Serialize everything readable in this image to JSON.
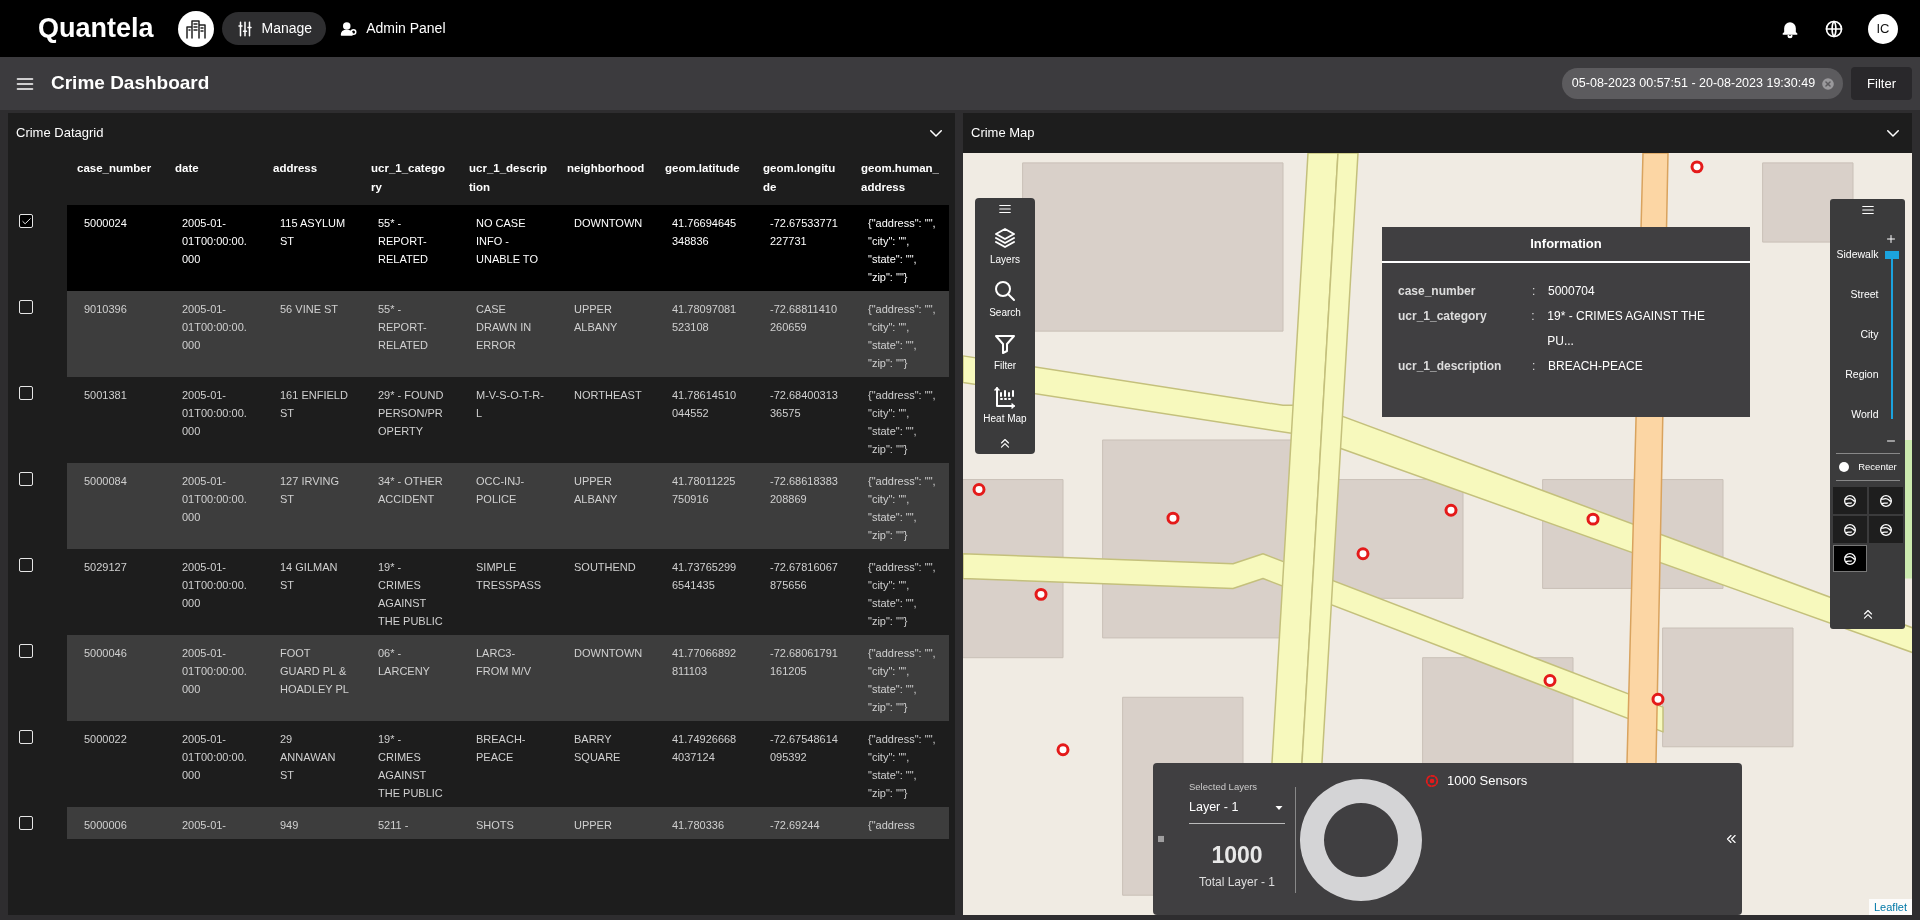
{
  "topbar": {
    "logo": "Quantela",
    "nav": [
      {
        "label": "Manage",
        "kind": "manage",
        "selected": true
      },
      {
        "label": "Admin Panel",
        "kind": "admin",
        "selected": false
      }
    ],
    "avatar": "IC"
  },
  "header": {
    "title": "Crime Dashboard",
    "date_range": "05-08-2023 00:57:51 - 20-08-2023 19:30:49",
    "filter_button": "Filter"
  },
  "datagrid": {
    "title": "Crime Datagrid",
    "columns": [
      "case_number",
      "date",
      "address",
      "ucr_1_category",
      "ucr_1_description",
      "neighborhood",
      "geom.latitude",
      "geom.longitude",
      "geom.human_address"
    ],
    "rows": [
      {
        "selected": true,
        "cells": [
          "5000024",
          "2005-01-01T00:00:00.000",
          "115 ASYLUM ST",
          "55* - REPORT-RELATED",
          "NO CASE INFO - UNABLE TO",
          "DOWNTOWN",
          "41.76694645348836",
          "-72.67533771227731",
          "{\"address\": \"\", \"city\": \"\", \"state\": \"\", \"zip\": \"\"}"
        ]
      },
      {
        "selected": false,
        "cells": [
          "9010396",
          "2005-01-01T00:00:00.000",
          "56 VINE ST",
          "55* - REPORT-RELATED",
          "CASE DRAWN IN ERROR",
          "UPPER ALBANY",
          "41.78097081523108",
          "-72.68811410260659",
          "{\"address\": \"\", \"city\": \"\", \"state\": \"\", \"zip\": \"\"}"
        ]
      },
      {
        "selected": false,
        "cells": [
          "5001381",
          "2005-01-01T00:00:00.000",
          "161 ENFIELD ST",
          "29* - FOUND PERSON/PROPERTY",
          "M-V-S-O-T-R-L",
          "NORTHEAST",
          "41.78614510044552",
          "-72.6840031336575",
          "{\"address\": \"\", \"city\": \"\", \"state\": \"\", \"zip\": \"\"}"
        ]
      },
      {
        "selected": false,
        "cells": [
          "5000084",
          "2005-01-01T00:00:00.000",
          "127 IRVING ST",
          "34* - OTHER ACCIDENT",
          "OCC-INJ-POLICE",
          "UPPER ALBANY",
          "41.78011225750916",
          "-72.68618383208869",
          "{\"address\": \"\", \"city\": \"\", \"state\": \"\", \"zip\": \"\"}"
        ]
      },
      {
        "selected": false,
        "cells": [
          "5029127",
          "2005-01-01T00:00:00.000",
          "14 GILMAN ST",
          "19* - CRIMES AGAINST THE PUBLIC",
          "SIMPLE TRESSPASS",
          "SOUTHEND",
          "41.737652996541435",
          "-72.67816067875656",
          "{\"address\": \"\", \"city\": \"\", \"state\": \"\", \"zip\": \"\"}"
        ]
      },
      {
        "selected": false,
        "cells": [
          "5000046",
          "2005-01-01T00:00:00.000",
          "FOOT GUARD PL & HOADLEY PL",
          "06* - LARCENY",
          "LARC3-FROM M/V",
          "DOWNTOWN",
          "41.77066892811103",
          "-72.68061791161205",
          "{\"address\": \"\", \"city\": \"\", \"state\": \"\", \"zip\": \"\"}"
        ]
      },
      {
        "selected": false,
        "cells": [
          "5000022",
          "2005-01-01T00:00:00.000",
          "29 ANNAWAN ST",
          "19* - CRIMES AGAINST THE PUBLIC",
          "BREACH-PEACE",
          "BARRY SQUARE",
          "41.749266684037124",
          "-72.67548614095392",
          "{\"address\": \"\", \"city\": \"\", \"state\": \"\", \"zip\": \"\"}"
        ]
      },
      {
        "selected": false,
        "cells": [
          "5000006",
          "2005-01-",
          "949",
          "5211 -",
          "SHOTS",
          "UPPER",
          "41.780336",
          "-72.69244",
          "{\"address"
        ]
      }
    ]
  },
  "map": {
    "title": "Crime Map",
    "toolbar": [
      {
        "kind": "layers",
        "label": "Layers"
      },
      {
        "kind": "search",
        "label": "Search"
      },
      {
        "kind": "filter",
        "label": "Filter"
      },
      {
        "kind": "heatmap",
        "label": "Heat Map"
      }
    ],
    "info": {
      "title": "Information",
      "fields": [
        {
          "key": "case_number",
          "colon": ":",
          "value": "5000704"
        },
        {
          "key": "ucr_1_category",
          "colon": ":",
          "value": "19* - CRIMES AGAINST THE PU..."
        },
        {
          "key": "ucr_1_description",
          "colon": ":",
          "value": "BREACH-PEACE"
        }
      ]
    },
    "zoom": {
      "labels": [
        "Sidewalk",
        "Street",
        "City",
        "Region",
        "World"
      ],
      "level": 1
    },
    "recenter": "Recenter",
    "base_maps": [
      {
        "selected": false
      },
      {
        "selected": false
      },
      {
        "selected": false
      },
      {
        "selected": false
      },
      {
        "selected": true
      }
    ],
    "layers_panel": {
      "label": "Selected Layers",
      "selected_layer": "Layer - 1",
      "total": "1000",
      "total_label": "Total Layer - 1",
      "legend": "1000 Sensors"
    },
    "attribution": "Leaflet"
  }
}
